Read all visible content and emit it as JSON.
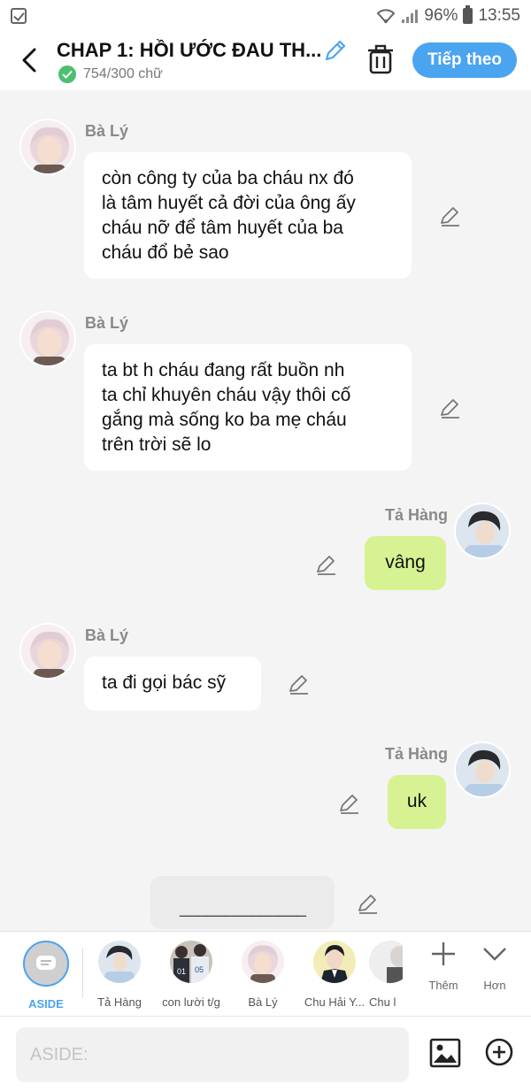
{
  "status_bar": {
    "battery": "96%",
    "time": "13:55"
  },
  "header": {
    "title": "CHAP 1: HỒI ƯỚC ĐAU TH...",
    "word_count": "754/300 chữ",
    "next_label": "Tiếp theo",
    "accent": "#4ba4f0"
  },
  "messages": [
    {
      "sender": "Bà Lý",
      "side": "left",
      "lines": [
        "còn công ty của ba cháu nx đó",
        "là tâm huyết cả đời của ông ấy",
        "cháu nỡ để tâm huyết của ba",
        "cháu đổ bẻ sao"
      ]
    },
    {
      "sender": "Bà Lý",
      "side": "left",
      "lines": [
        "ta bt h cháu đang rất buồn nh",
        "ta chỉ khuyên cháu vậy thôi cố",
        "gắng mà sống ko ba mẹ cháu",
        "trên trời sẽ lo"
      ]
    },
    {
      "sender": "Tả Hàng",
      "side": "right",
      "lines": [
        "vâng"
      ]
    },
    {
      "sender": "Bà Lý",
      "side": "left",
      "lines": [
        "ta đi gọi bác sỹ"
      ]
    },
    {
      "sender": "Tả Hàng",
      "side": "right",
      "lines": [
        "uk"
      ]
    }
  ],
  "divider_text": "______________",
  "character_bar": {
    "aside_label": "ASIDE",
    "characters": [
      {
        "name": "Tả Hàng"
      },
      {
        "name": "con lười t/g"
      },
      {
        "name": "Bà Lý"
      },
      {
        "name": "Chu Hải Y..."
      },
      {
        "name": "Chu l"
      }
    ],
    "add_label": "Thêm",
    "more_label": "Hơn"
  },
  "composer": {
    "placeholder": "ASIDE:"
  }
}
